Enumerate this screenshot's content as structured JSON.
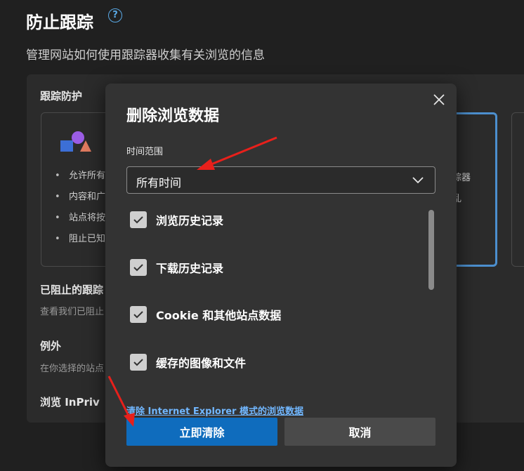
{
  "page": {
    "title": "防止跟踪",
    "subtitle": "管理网站如何使用跟踪器收集有关浏览的信息",
    "help_icon": "question-circle-icon"
  },
  "tracking_prevention": {
    "section_label": "跟踪防护",
    "left_card": {
      "bullets": [
        "允许所有",
        "内容和广",
        "站点将按",
        "阻止已知"
      ]
    },
    "mid_card": {
      "lines": [
        "踪器",
        "乱"
      ]
    }
  },
  "blocked_trackers": {
    "heading": "已阻止的跟踪",
    "description": "查看我们已阻止"
  },
  "exceptions": {
    "heading": "例外",
    "description": "在你选择的站点"
  },
  "inprivate": {
    "heading": "浏览 InPriv"
  },
  "dialog": {
    "title": "删除浏览数据",
    "time_range_label": "时间范围",
    "time_range_value": "所有时间",
    "options": [
      {
        "label": "浏览历史记录",
        "checked": true
      },
      {
        "label": "下载历史记录",
        "checked": true
      },
      {
        "label": "Cookie 和其他站点数据",
        "checked": true
      },
      {
        "label": "缓存的图像和文件",
        "checked": true
      }
    ],
    "ie_link": "清除 Internet Explorer 模式的浏览数据",
    "clear_button": "立即清除",
    "cancel_button": "取消"
  },
  "colors": {
    "accent": "#0f6cbd",
    "annotation_arrow": "#e8201b",
    "link": "#71b7ff"
  }
}
